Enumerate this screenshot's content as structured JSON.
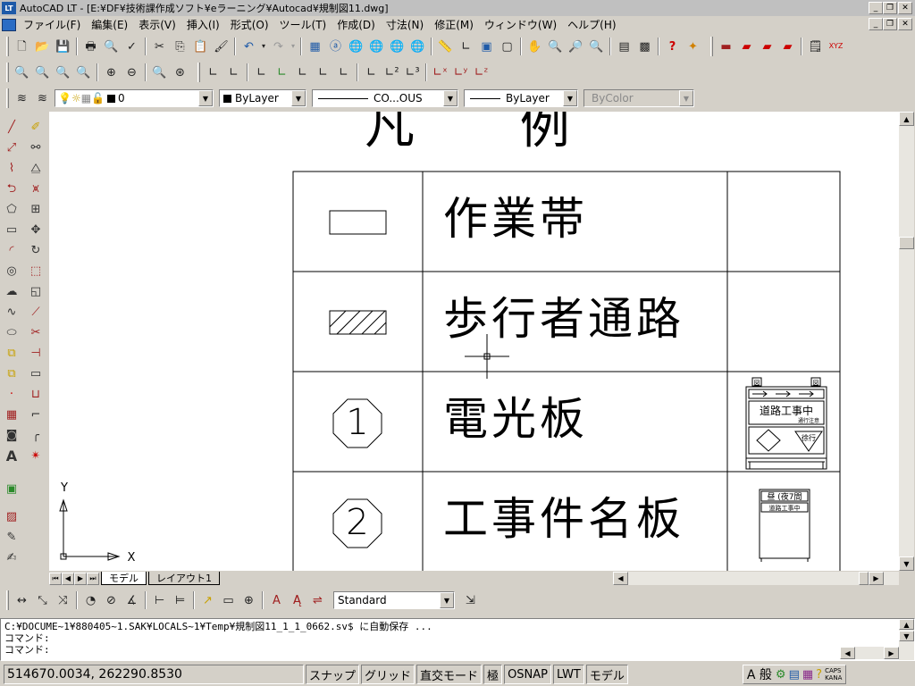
{
  "window": {
    "title": "AutoCAD LT - [E:¥DF¥技術課作成ソフト¥eラーニング¥Autocad¥規制図11.dwg]"
  },
  "menubar": {
    "items": [
      "ファイル(F)",
      "編集(E)",
      "表示(V)",
      "挿入(I)",
      "形式(O)",
      "ツール(T)",
      "作成(D)",
      "寸法(N)",
      "修正(M)",
      "ウィンドウ(W)",
      "ヘルプ(H)"
    ]
  },
  "layer_toolbar": {
    "layer_value": "0",
    "color_value": "ByLayer",
    "linetype_value": "CO...OUS",
    "lineweight_value": "ByLayer",
    "plotstyle_value": "ByColor"
  },
  "drawing": {
    "title": "凡 例",
    "rows": [
      {
        "symbol": "rectangle",
        "label": "作業帯",
        "image": ""
      },
      {
        "symbol": "hatched-rectangle",
        "label": "歩行者通路",
        "image": ""
      },
      {
        "symbol": "circled-1",
        "symbol_text": "1",
        "label": "電光板",
        "image": "signboard"
      },
      {
        "symbol": "circled-2",
        "symbol_text": "2",
        "label": "工事件名板",
        "image": "name-board"
      }
    ],
    "signboard": {
      "text": "道路工事中",
      "subtext": "通行注意",
      "sign_text": "徐行",
      "marks": [
        "図",
        "図"
      ]
    },
    "name_board": {
      "top_text": "昼 (夜7間",
      "second_text": "道路工事中"
    },
    "ucs": {
      "y_label": "Y",
      "x_label": "X"
    }
  },
  "layout_tabs": [
    {
      "label": "モデル",
      "active": true
    },
    {
      "label": "レイアウト1",
      "active": false
    }
  ],
  "dim_toolbar": {
    "style_value": "Standard"
  },
  "command": {
    "lines": [
      "C:¥DOCUME~1¥880405~1.SAK¥LOCALS~1¥Temp¥規制図11_1_1_0662.sv$ に自動保存 ...",
      "コマンド:",
      "コマンド:"
    ]
  },
  "status": {
    "coordinates": "514670.0034, 262290.8530",
    "buttons": [
      "スナップ",
      "グリッド",
      "直交モード",
      "極",
      "OSNAP",
      "LWT",
      "モデル"
    ],
    "ime": {
      "mode": "A 般",
      "caps": "CAPS",
      "kana": "KANA"
    }
  },
  "colors": {
    "chrome": "#d4d0c8",
    "canvas": "#ffffff",
    "drawing_line": "#000000"
  }
}
